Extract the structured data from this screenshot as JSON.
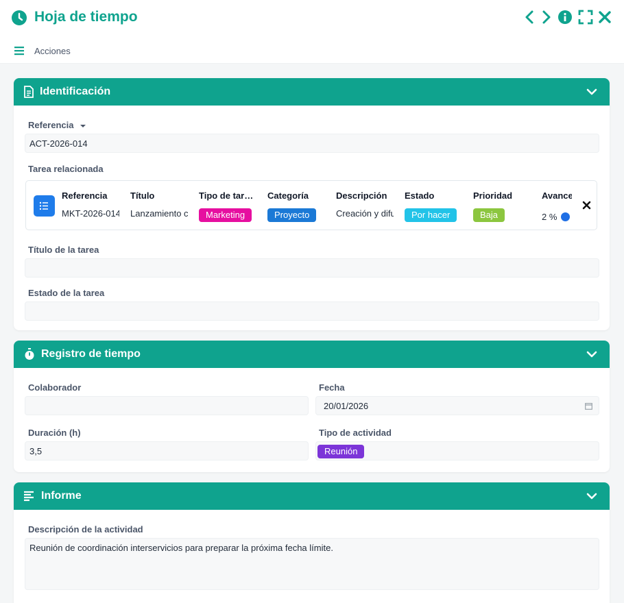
{
  "window": {
    "title": "Hoja de tiempo",
    "icons": [
      "clock-icon",
      "chevron-left-icon",
      "chevron-right-icon",
      "info-icon",
      "fullscreen-icon",
      "close-icon"
    ]
  },
  "actions": {
    "label": "Acciones"
  },
  "colors": {
    "accent": "#0fa38e",
    "marketing": "#e60fa0",
    "proyecto": "#1b79d6",
    "por_hacer": "#22c3e8",
    "baja": "#8cc63f",
    "reunion": "#7c35d8",
    "progress": "#1f6fe5"
  },
  "identificacion": {
    "title": "Identificación",
    "referencia_label": "Referencia",
    "referencia_value": "ACT-2026-014",
    "tarea_label": "Tarea relacionada",
    "grid": {
      "headers": [
        "Referencia",
        "Título",
        "Tipo de tar…",
        "Categoría",
        "Descripción",
        "Estado",
        "Prioridad",
        "Avance"
      ],
      "row": {
        "referencia": "MKT-2026-014",
        "titulo": "Lanzamiento campaña",
        "tipo": "Marketing",
        "categoria": "Proyecto",
        "descripcion": "Creación y difusión",
        "estado": "Por hacer",
        "prioridad": "Baja",
        "avance_text": "2 %",
        "avance_value": 2
      }
    },
    "titulo_tarea_label": "Título de la tarea",
    "titulo_tarea_value": "",
    "estado_tarea_label": "Estado de la tarea",
    "estado_tarea_value": ""
  },
  "registro": {
    "title": "Registro de tiempo",
    "colaborador_label": "Colaborador",
    "colaborador_value": "",
    "fecha_label": "Fecha",
    "fecha_value": "20/01/2026",
    "duracion_label": "Duración (h)",
    "duracion_value": "3,5",
    "tipo_label": "Tipo de actividad",
    "tipo_value": "Reunión"
  },
  "informe": {
    "title": "Informe",
    "descripcion_label": "Descripción de la actividad",
    "descripcion_value": "Reunión de coordinación interservicios para preparar la próxima fecha límite."
  }
}
